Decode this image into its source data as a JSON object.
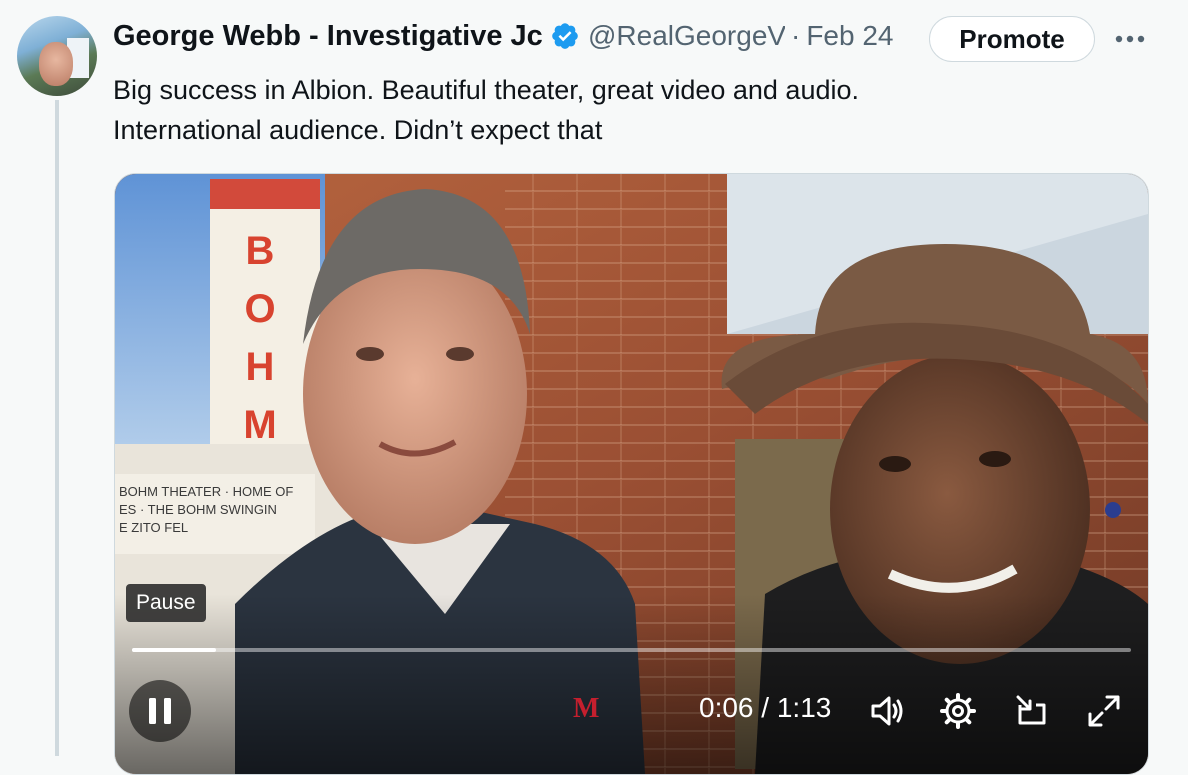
{
  "tweet": {
    "author_name": "George Webb - Investigative Jc",
    "handle": "@RealGeorgeV",
    "separator": "·",
    "date": "Feb 24",
    "text_line1": "Big success in Albion.  Beautiful theater, great video and audio.",
    "text_line2": "International audience. Didn’t expect that"
  },
  "actions": {
    "promote_label": "Promote",
    "more_label": "•••"
  },
  "video": {
    "sign_letters": [
      "B",
      "O",
      "H",
      "M"
    ],
    "marquee_line1": "BOHM THEATER · HOME OF",
    "marquee_line2": "ES · THE BOHM   SWINGIN",
    "marquee_line3": "E ZITO        FEL",
    "shirt_logo": "M",
    "tooltip": "Pause",
    "current_time": "0:06",
    "time_separator": " / ",
    "duration": "1:13",
    "progress_fraction": 0.084
  },
  "icons": {
    "verified": "verified-badge-icon",
    "more": "more-dots-icon",
    "pause": "pause-icon",
    "volume": "volume-icon",
    "settings": "gear-icon",
    "pip": "picture-in-picture-icon",
    "fullscreen": "fullscreen-icon"
  },
  "colors": {
    "verified_blue": "#1d9bf0",
    "thread_line": "#cfd9de",
    "text_primary": "#0f1419",
    "text_secondary": "#536471"
  }
}
